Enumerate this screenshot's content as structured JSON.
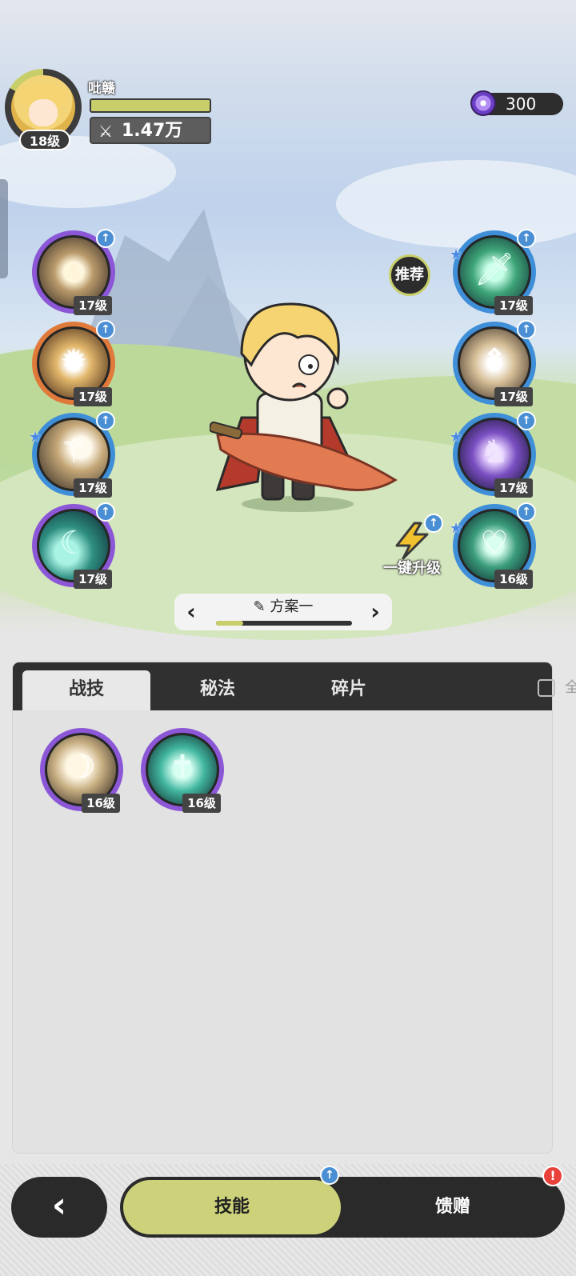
{
  "player": {
    "name": "吡赣",
    "level": "18级",
    "power": "1.47万",
    "exp_fraction": 1.0,
    "power_icon": "crossed-swords-icon"
  },
  "currency": {
    "icon": "purple-gem-icon",
    "value": "300"
  },
  "skills_left": [
    {
      "id": "left-1",
      "level": "17级",
      "icon": "rock-burst-icon",
      "frame": "purple",
      "upgrade": true,
      "star": false
    },
    {
      "id": "left-2",
      "level": "17级",
      "icon": "explosion-icon",
      "frame": "orange",
      "upgrade": true,
      "star": false
    },
    {
      "id": "left-3",
      "level": "17级",
      "icon": "slash-figure-icon",
      "frame": "blue",
      "upgrade": true,
      "star": true
    },
    {
      "id": "left-4",
      "level": "17级",
      "icon": "crescent-wind-icon",
      "frame": "purple",
      "upgrade": true,
      "star": false
    }
  ],
  "skills_right": [
    {
      "id": "right-1",
      "level": "17级",
      "icon": "green-sword-icon",
      "frame": "blue",
      "upgrade": true,
      "star": true
    },
    {
      "id": "right-2",
      "level": "17级",
      "icon": "sword-up-icon",
      "frame": "blue",
      "upgrade": true,
      "star": false
    },
    {
      "id": "right-3",
      "level": "17级",
      "icon": "shadow-beast-icon",
      "frame": "blue",
      "upgrade": true,
      "star": true
    },
    {
      "id": "right-4",
      "level": "16级",
      "icon": "heart-heal-icon",
      "frame": "blue",
      "upgrade": true,
      "star": true
    }
  ],
  "recommend_label": "推荐",
  "one_click_upgrade_label": "一键升级",
  "scheme": {
    "label": "方案一",
    "progress": 0.2,
    "edit_icon": "pencil-icon"
  },
  "panel": {
    "tabs": [
      "战技",
      "秘法",
      "碎片"
    ],
    "active_tab": "战技",
    "check_all_label": "全部",
    "items": [
      {
        "level": "16级",
        "icon": "sweeping-slash-icon",
        "frame": "purple"
      },
      {
        "level": "16级",
        "icon": "sword-burst-icon",
        "frame": "purple"
      }
    ]
  },
  "bottom_nav": {
    "back_icon": "chevron-left-icon",
    "tabs": [
      "技能",
      "馈赠"
    ],
    "active_tab": "技能",
    "skills_badge": "upgrade-arrow-icon",
    "gift_badge": "!"
  },
  "colors": {
    "accent": "#c8cf6a",
    "dark": "#2a2a2a",
    "frame_purple": "#8c57d6",
    "frame_blue": "#3f8fd8",
    "frame_orange": "#e07a3a",
    "alert": "#e8413c"
  }
}
